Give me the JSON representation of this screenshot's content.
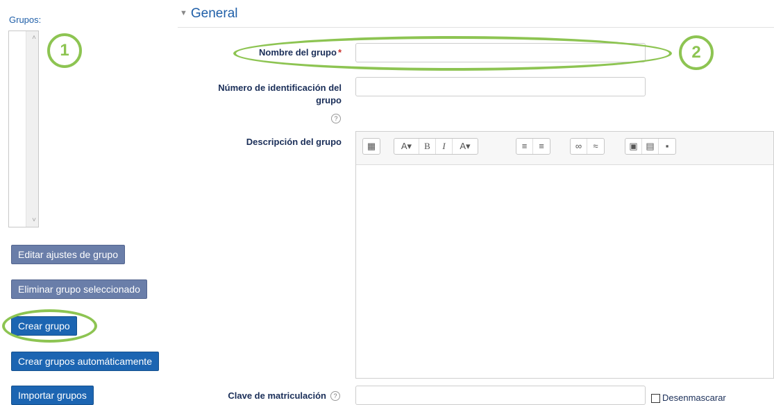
{
  "left": {
    "groups_label": "Grupos:",
    "buttons": {
      "edit": "Editar ajustes de grupo",
      "delete": "Eliminar grupo seleccionado",
      "create": "Crear grupo",
      "auto_create": "Crear grupos automáticamente",
      "import": "Importar grupos"
    }
  },
  "annotations": {
    "one": "1",
    "two": "2"
  },
  "form": {
    "legend": "General",
    "name_label": "Nombre del grupo",
    "required_mark": "*",
    "idnumber_label_1": "Número de identificación del",
    "idnumber_label_2": "grupo",
    "description_label": "Descripción del grupo",
    "enrolment_key_label": "Clave de matriculación",
    "unmask_label": "Desenmascarar",
    "help_glyph": "?"
  },
  "toolbar_icons": [
    "toggle-toolbar-icon",
    "font-size-icon",
    "bold-icon",
    "italic-icon",
    "text-color-icon",
    "bullet-list-icon",
    "numbered-list-icon",
    "link-icon",
    "unlink-icon",
    "image-icon",
    "media-icon",
    "paste-icon"
  ],
  "colors": {
    "accent_green": "#8dc452",
    "button_blue": "#1c65b2",
    "button_gray": "#6a7ea9",
    "label_navy": "#1a2e58"
  }
}
